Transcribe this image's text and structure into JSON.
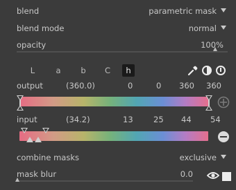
{
  "blend": {
    "label": "blend",
    "value": "parametric mask"
  },
  "blend_mode": {
    "label": "blend mode",
    "value": "normal"
  },
  "opacity": {
    "label": "opacity",
    "value": "100%",
    "level": 1.0
  },
  "channels": {
    "tabs": [
      "L",
      "a",
      "b",
      "C",
      "h"
    ],
    "active": "h"
  },
  "icons": {
    "picker": "color-picker-icon",
    "invert": "invert-polarity-icon",
    "reset": "reset-icon",
    "add": "add-circle-icon",
    "remove": "remove-circle-icon",
    "eye": "eye-icon",
    "mask": "mask-display-icon"
  },
  "output": {
    "label": "output",
    "picked": "(360.0)",
    "values": [
      "0",
      "0",
      "360",
      "360"
    ]
  },
  "input": {
    "label": "input",
    "picked": "(34.2)",
    "values": [
      "13",
      "25",
      "44",
      "54"
    ]
  },
  "combine_masks": {
    "label": "combine masks",
    "value": "exclusive"
  },
  "mask_blur": {
    "label": "mask blur",
    "value": "0.0",
    "level": 0.0
  }
}
